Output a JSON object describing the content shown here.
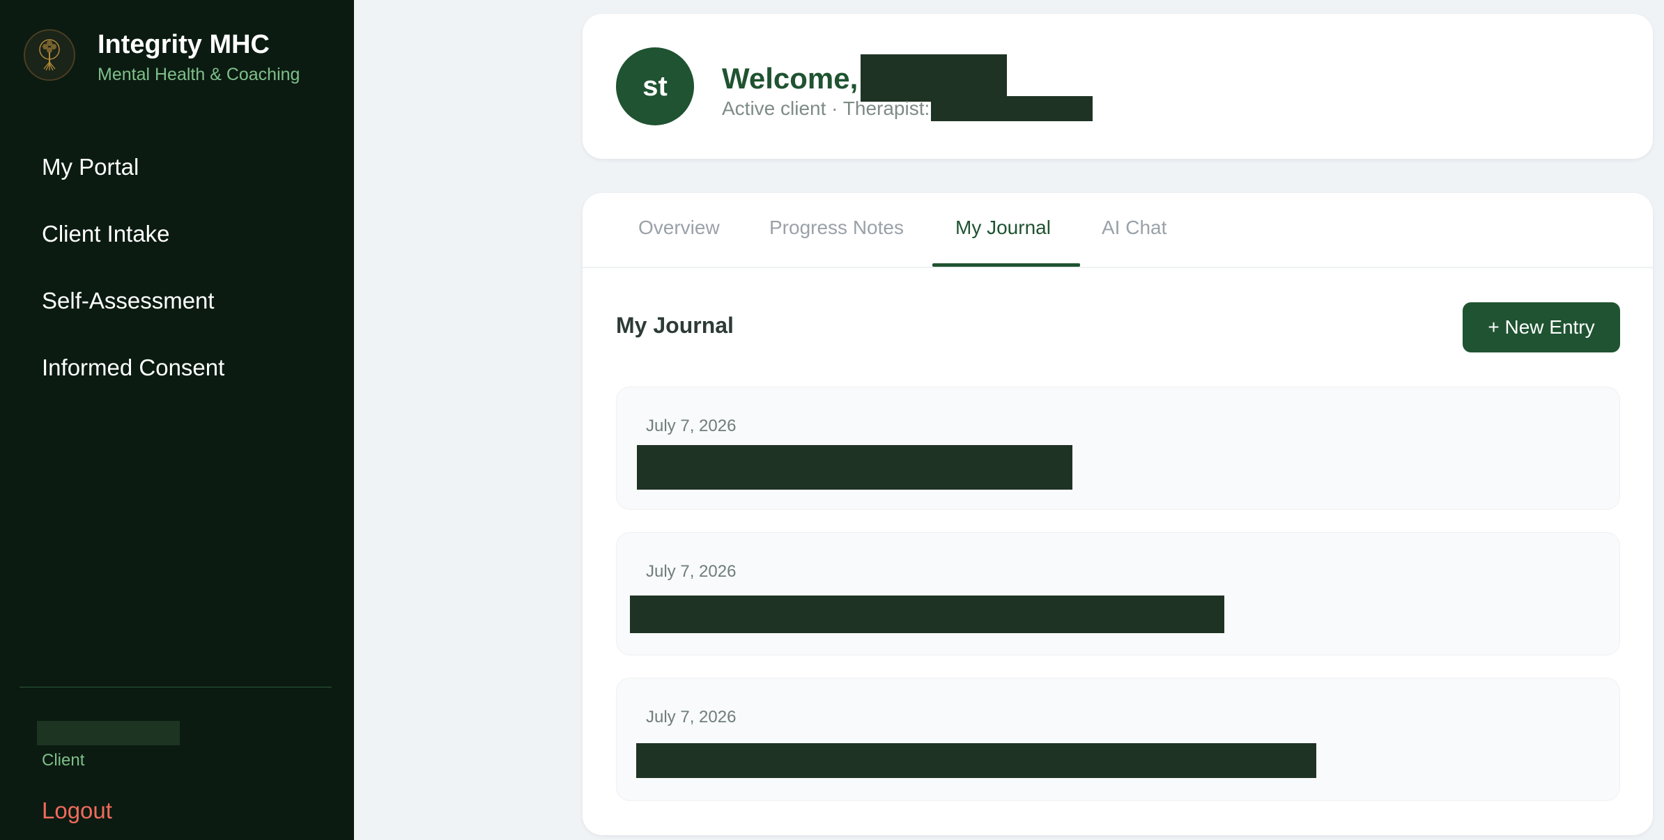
{
  "brand": {
    "title": "Integrity MHC",
    "subtitle": "Mental Health & Coaching",
    "logo_icon": "tree-of-life-icon"
  },
  "nav": {
    "items": [
      {
        "label": "My Portal"
      },
      {
        "label": "Client Intake"
      },
      {
        "label": "Self-Assessment"
      },
      {
        "label": "Informed Consent"
      }
    ]
  },
  "user": {
    "role": "Client",
    "logout_label": "Logout"
  },
  "header": {
    "avatar_initials": "st",
    "welcome_label": "Welcome,",
    "status_text": "Active client · Therapist:"
  },
  "tabs": [
    {
      "label": "Overview",
      "active": false
    },
    {
      "label": "Progress Notes",
      "active": false
    },
    {
      "label": "My Journal",
      "active": true
    },
    {
      "label": "AI Chat",
      "active": false
    }
  ],
  "journal": {
    "title": "My Journal",
    "new_entry_label": "+ New Entry",
    "entries": [
      {
        "date": "July 7, 2026"
      },
      {
        "date": "July 7, 2026"
      },
      {
        "date": "July 7, 2026"
      }
    ]
  },
  "colors": {
    "sidebar_bg": "#0b1b11",
    "accent": "#1f5331",
    "accent_light": "#7fbf8a",
    "logout": "#ef6b5c",
    "page_bg": "#eff3f6"
  }
}
